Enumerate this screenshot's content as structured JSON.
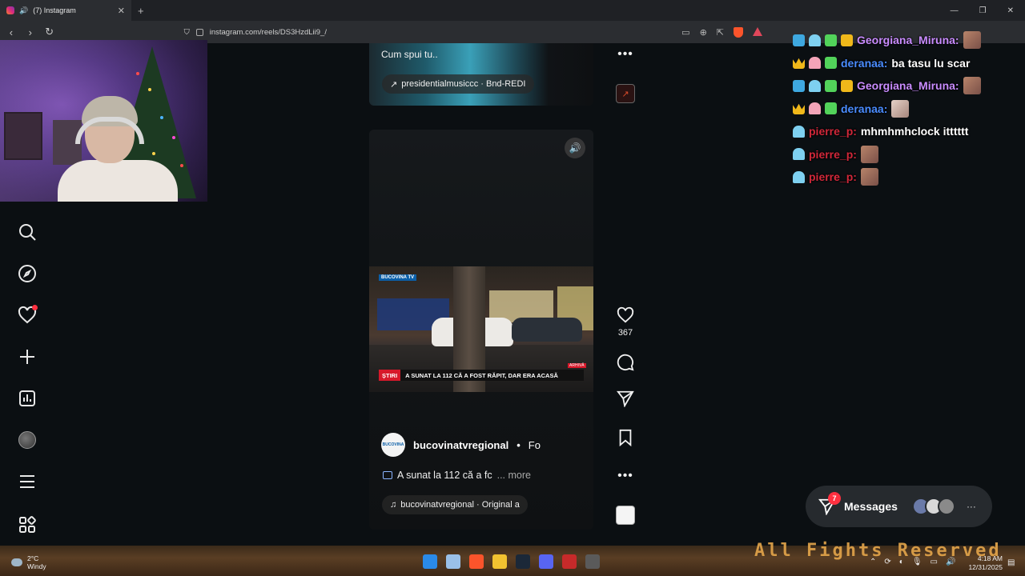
{
  "browser": {
    "tab_title": "(7) Instagram",
    "new_tab_symbol": "+",
    "url": "instagram.com/reels/DS3HzdLii9_/"
  },
  "reel_top": {
    "caption": "Cum spui tu..",
    "audio_label": "presidentialmusiccc · Bnd-REDI"
  },
  "reel_main": {
    "video_logo": "BUCOVINA TV",
    "ticker_tag": "ȘTIRI",
    "ticker_text": "A SUNAT LA 112 CĂ A FOST RĂPIT, DAR ERA ACASĂ",
    "ticker_badge": "ARHIVĂ",
    "author": "bucovinatvregional",
    "author_separator": "•",
    "follow_label": "Fo",
    "description": "A sunat la 112 că a fc",
    "more_label": "... more",
    "audio_label": "bucovinatvregional · Original a",
    "avatar_text": "BUCOVINA"
  },
  "rail": {
    "like_count": "367"
  },
  "chat": [
    {
      "badges": [
        "blue",
        "ghost",
        "gift",
        "gold"
      ],
      "name": "Georgiana_Miruna:",
      "color": "purple",
      "message": "",
      "emote": true,
      "emote_pale": false
    },
    {
      "badges": [
        "crown",
        "pink",
        "gift"
      ],
      "name": "deranaa:",
      "color": "blue",
      "message": "ba tasu lu scar",
      "emote": false,
      "emote_pale": false
    },
    {
      "badges": [
        "blue",
        "ghost",
        "gift",
        "gold"
      ],
      "name": "Georgiana_Miruna:",
      "color": "purple",
      "message": "",
      "emote": true,
      "emote_pale": false
    },
    {
      "badges": [
        "crown",
        "pink",
        "gift"
      ],
      "name": "deranaa:",
      "color": "blue",
      "message": "",
      "emote": true,
      "emote_pale": true
    },
    {
      "badges": [
        "ghost"
      ],
      "name": "pierre_p:",
      "color": "red",
      "message": "mhmhmhclock itttttt",
      "emote": false,
      "emote_pale": false
    },
    {
      "badges": [
        "ghost"
      ],
      "name": "pierre_p:",
      "color": "red",
      "message": "",
      "emote": true,
      "emote_pale": false
    },
    {
      "badges": [
        "ghost"
      ],
      "name": "pierre_p:",
      "color": "red",
      "message": "",
      "emote": true,
      "emote_pale": false
    }
  ],
  "messages": {
    "label": "Messages",
    "unread": "7",
    "more": "···"
  },
  "overlay": {
    "arcade_text": "All Fights Reserved"
  },
  "taskbar": {
    "temperature": "2°C",
    "condition": "Windy",
    "time": "4:18 AM",
    "date": "12/31/2025"
  },
  "colors": {
    "chat_purple": "#c98cff",
    "chat_blue": "#4a8cff",
    "chat_red": "#d0283a",
    "ig_red": "#ff3040",
    "page_bg": "#0b0f12"
  }
}
